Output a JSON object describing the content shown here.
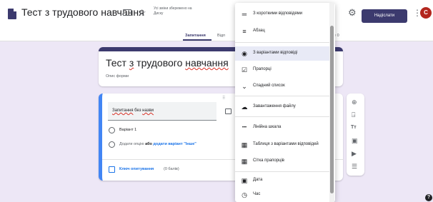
{
  "header": {
    "doc_title": "Тест з трудового навчання",
    "saved_status": "Усі зміни збережено на Диску",
    "send_label": "Надіслати",
    "avatar_letter": "C",
    "tabs": [
      {
        "label": "Запитання",
        "active": true
      },
      {
        "label": "Відп",
        "active": false
      },
      {
        "label": "e 0",
        "active": false
      }
    ],
    "icons": [
      "doc-icon",
      "folder-icon",
      "star-icon",
      "preview-icon",
      "settings-icon",
      "more-icon"
    ]
  },
  "form": {
    "title_before": "Тест ",
    "title_underlined": "з",
    "title_middle": " трудового ",
    "title_underlined2": "навчання",
    "description_placeholder": "Опис форми"
  },
  "question": {
    "drag_handle": "⠿",
    "title_underlined": "Запитання",
    "title_rest": " без ",
    "title_underlined2": "назви",
    "option1": "Варіант 1",
    "add_option": "Додати опцію",
    "or": "або",
    "add_other": "додати варіант \"Інше\"",
    "answer_key": "Ключ опитування",
    "points": "(0 балів)"
  },
  "question_types_menu": {
    "items": [
      {
        "label": "З короткими відповідями",
        "icon": "short-answer-icon",
        "glyph": "═"
      },
      {
        "label": "Абзац",
        "icon": "paragraph-icon",
        "glyph": "≡"
      },
      {
        "label": "З варіантами відповіді",
        "icon": "radio-icon",
        "glyph": "◉",
        "selected": true
      },
      {
        "label": "Прапорці",
        "icon": "checkbox-icon",
        "glyph": "☑"
      },
      {
        "label": "Спадний список",
        "icon": "dropdown-icon",
        "glyph": "⌄"
      },
      {
        "label": "Завантаження файлу",
        "icon": "upload-icon",
        "glyph": "☁"
      },
      {
        "label": "Лінійна шкала",
        "icon": "linear-scale-icon",
        "glyph": "•••"
      },
      {
        "label": "Таблиця з варіантами відповідей",
        "icon": "grid-icon",
        "glyph": "▦"
      },
      {
        "label": "Сітка прапорців",
        "icon": "checkbox-grid-icon",
        "glyph": "▦"
      },
      {
        "label": "Дата",
        "icon": "date-icon",
        "glyph": "▣"
      },
      {
        "label": "Час",
        "icon": "time-icon",
        "glyph": "◷"
      }
    ]
  },
  "floating_toolbar": {
    "icons": [
      {
        "name": "add-question-icon",
        "glyph": "⊕"
      },
      {
        "name": "import-questions-icon",
        "glyph": "⍈"
      },
      {
        "name": "add-title-icon",
        "glyph": "Tт"
      },
      {
        "name": "add-image-icon",
        "glyph": "▣"
      },
      {
        "name": "add-video-icon",
        "glyph": "▶"
      },
      {
        "name": "add-section-icon",
        "glyph": "☰"
      }
    ]
  },
  "help": "?",
  "colors": {
    "accent": "#3c3a6e",
    "background": "#ede7f6",
    "question_border": "#4285f4",
    "link": "#1a73e8",
    "avatar": "#b3261e"
  }
}
